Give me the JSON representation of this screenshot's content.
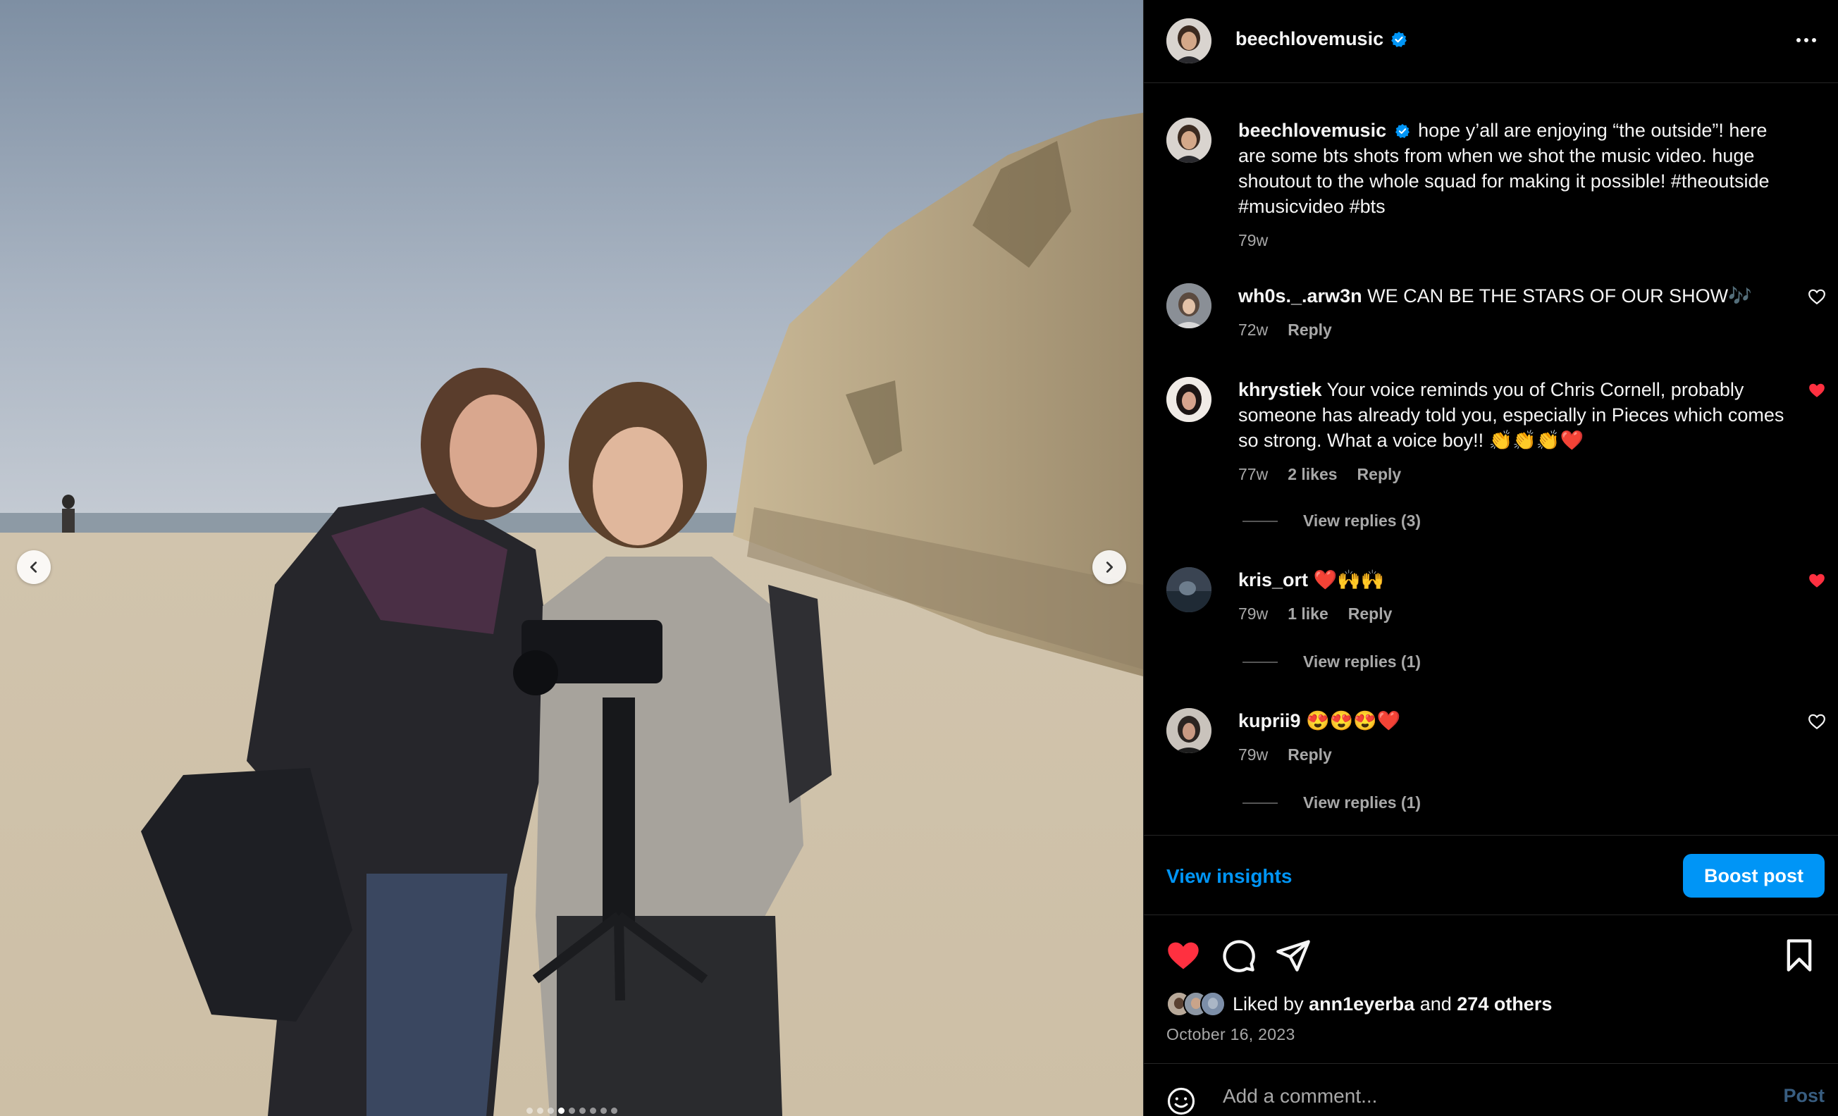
{
  "post": {
    "username": "beechlovemusic",
    "caption": "hope y’all are enjoying “the outside”! here are some bts shots from when we shot the music video. huge shoutout to the whole squad for making it possible! #theoutside #musicvideo #bts",
    "caption_age": "79w"
  },
  "carousel": {
    "total_slides": 9,
    "active_slide": 4
  },
  "comments": [
    {
      "username": "wh0s._.arw3n",
      "text": "WE CAN BE THE STARS OF OUR SHOW🎶",
      "age": "72w",
      "likes": "",
      "reply": "Reply",
      "liked": false,
      "view_replies": ""
    },
    {
      "username": "khrystiek",
      "text": "Your voice reminds you of Chris Cornell, probably someone has already told you, especially in Pieces which comes so strong. What a voice boy!! 👏👏👏❤️",
      "age": "77w",
      "likes": "2 likes",
      "reply": "Reply",
      "liked": true,
      "view_replies": "View replies (3)"
    },
    {
      "username": "kris_ort",
      "text": "❤️🙌🙌",
      "age": "79w",
      "likes": "1 like",
      "reply": "Reply",
      "liked": true,
      "view_replies": "View replies (1)"
    },
    {
      "username": "kuprii9",
      "text": "😍😍😍❤️",
      "age": "79w",
      "likes": "",
      "reply": "Reply",
      "liked": false,
      "view_replies": "View replies (1)"
    }
  ],
  "insights": {
    "view_label": "View insights",
    "boost_label": "Boost post"
  },
  "actions": {
    "liked": true
  },
  "likes": {
    "prefix": "Liked by",
    "first_user": "ann1eyerba",
    "conj": "and",
    "others": "274 others"
  },
  "date": "October 16, 2023",
  "composer": {
    "placeholder": "Add a comment...",
    "post_label": "Post"
  },
  "colors": {
    "accent": "#0095f6",
    "like_red": "#ff3040",
    "background": "#000000",
    "muted": "#a8a8a8"
  }
}
